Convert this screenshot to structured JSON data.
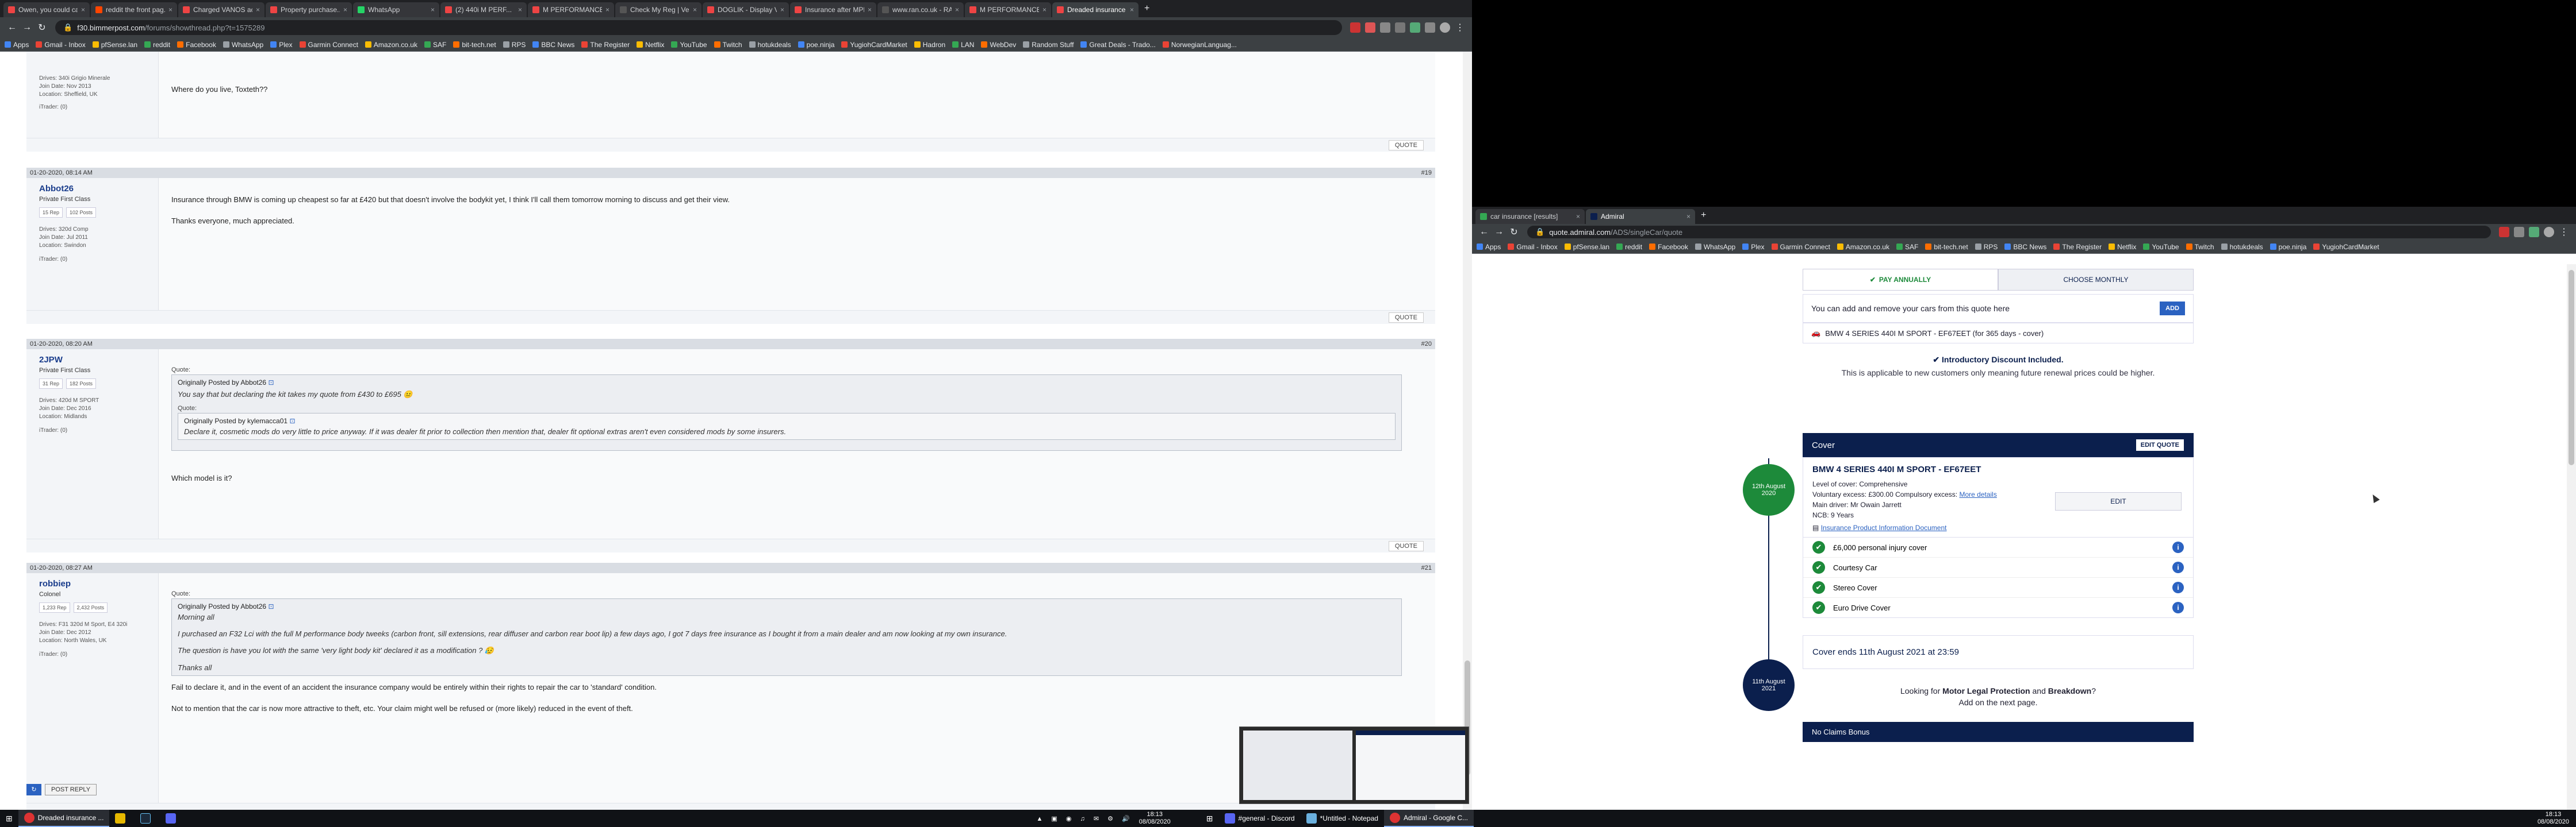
{
  "left_browser": {
    "tabs": [
      "Owen, you could ca...",
      "reddit the front pag...",
      "Charged VANOS acc...",
      "Property purchase...",
      "WhatsApp",
      "(2) 440i M PERF...",
      "M PERFORMANCE...",
      "Check My Reg | Veh...",
      "DOGLIK - Display Ve...",
      "Insurance after MPE...",
      "www.ran.co.uk - RAC",
      "M PERFORMANCE Ki...",
      "Dreaded insurance ..."
    ],
    "url_host": "f30.bimmerpost.com",
    "url_path": "/forums/showthread.php?t=1575289",
    "bookmarks": [
      "Apps",
      "Gmail - Inbox",
      "pfSense.lan",
      "reddit",
      "Facebook",
      "WhatsApp",
      "Plex",
      "Garmin Connect",
      "Amazon.co.uk",
      "SAF",
      "bit-tech.net",
      "RPS",
      "BBC News",
      "The Register",
      "Netflix",
      "YouTube",
      "Twitch",
      "hotukdeals",
      "poe.ninja",
      "YugiohCardMarket",
      "Hadron",
      "LAN",
      "WebDev",
      "Random Stuff",
      "Great Deals - Trado...",
      "NorwegianLanguag..."
    ]
  },
  "forum": {
    "top_snippet": {
      "side_lines": [
        "Drives: 340i Grigio Minerale",
        "Join Date: Nov 2013",
        "Location: Sheffield, UK",
        "iTrader: (0)"
      ],
      "text": "Where do you live, Toxteth??"
    },
    "posts": [
      {
        "date": "01-20-2020, 08:14 AM",
        "num": "#19",
        "user": "Abbot26",
        "title": "Private First Class",
        "stats": [
          "15 Rep",
          "102 Posts"
        ],
        "side_lines": [
          "Drives: 320d Comp",
          "Join Date: Jul 2011",
          "Location: Swindon",
          "iTrader: (0)"
        ],
        "lines": [
          "Insurance through BMW is coming up cheapest so far at £420 but that doesn't involve the bodykit yet, I think I'll call them tomorrow morning to discuss and get their view.",
          "Thanks everyone, much appreciated."
        ]
      },
      {
        "date": "01-20-2020, 08:20 AM",
        "num": "#20",
        "user": "2JPW",
        "title": "Private First Class",
        "stats": [
          "31 Rep",
          "182 Posts"
        ],
        "side_lines": [
          "Drives: 420d M SPORT",
          "Join Date: Dec 2016",
          "Location: Midlands",
          "iTrader: (0)"
        ],
        "quote_by": "Originally Posted by Abbot26",
        "quote_text": "You say that but declaring the kit takes my quote from £430 to £695 😐",
        "inner_quote_by": "Originally Posted by kylemacca01",
        "inner_quote_text": "Declare it, cosmetic mods do very little to price anyway. If it was dealer fit prior to collection then mention that, dealer fit optional extras aren't even considered mods by some insurers.",
        "reply": "Which model is it?"
      },
      {
        "date": "01-20-2020, 08:27 AM",
        "num": "#21",
        "user": "robbiep",
        "title": "Colonel",
        "stats": [
          "1,233 Rep",
          "2,432 Posts"
        ],
        "side_lines": [
          "Drives: F31 320d M Sport, E4 320i",
          "Join Date: Dec 2012",
          "Location: North Wales, UK",
          "iTrader: (0)"
        ],
        "quote_by": "Originally Posted by Abbot26",
        "quote_lines": [
          "Morning all",
          "I purchased an F32 Lci with the full M performance body tweeks (carbon front, sill extensions, rear diffuser and carbon rear boot lip) a few days ago, I got 7 days free insurance as I bought it from a main dealer and am now looking at my own insurance.",
          "The question is have you lot with the same 'very light body kit' declared it as a modification ? 😥",
          "Thanks all"
        ],
        "reply_lines": [
          "Fail to declare it, and in the event of an accident the insurance company would be entirely within their rights to repair the car to 'standard' condition.",
          "Not to mention that the car is now more attractive to theft, etc. Your claim might well be refused or (more likely) reduced in the event of theft."
        ]
      }
    ],
    "quote_label": "Quote:",
    "quote_button": "QUOTE",
    "post_reply": "POST REPLY"
  },
  "right_browser": {
    "tabs": [
      "car insurance [results]",
      "Admiral"
    ],
    "url_host": "quote.admiral.com",
    "url_path": "/ADS/singleCar/quote",
    "bookmarks": [
      "Apps",
      "Gmail - Inbox",
      "pfSense.lan",
      "reddit",
      "Facebook",
      "WhatsApp",
      "Plex",
      "Garmin Connect",
      "Amazon.co.uk",
      "SAF",
      "bit-tech.net",
      "RPS",
      "BBC News",
      "The Register",
      "Netflix",
      "YouTube",
      "Twitch",
      "hotukdeals",
      "poe.ninja",
      "YugiohCardMarket"
    ]
  },
  "admiral": {
    "pay_annually": "PAY ANNUALLY",
    "choose_monthly": "CHOOSE MONTHLY",
    "add_remove": "You can add and remove your cars from this quote here",
    "add_btn": "ADD",
    "car_line": "BMW 4 SERIES 440I M SPORT - EF67EET (for 365 days - cover)",
    "intro_title": "Introductory Discount Included.",
    "intro_sub": "This is applicable to new customers only meaning future renewal prices could be higher.",
    "cover_title": "Cover",
    "edit_quote": "EDIT QUOTE",
    "start_date": "12th August 2020",
    "end_date": "11th August 2021",
    "vehicle": "BMW 4 SERIES 440I M SPORT - EF67EET",
    "level": "Level of cover: Comprehensive",
    "excess": "Voluntary excess: £300.00 Compulsory excess:",
    "more_details": "More details",
    "main_driver": "Main driver: Mr Owain Jarrett",
    "ncb": "NCB: 9 Years",
    "ipid": "Insurance Product Information Document",
    "edit": "EDIT",
    "features": [
      "£6,000 personal injury cover",
      "Courtesy Car",
      "Stereo Cover",
      "Euro Drive Cover"
    ],
    "cover_ends": "Cover ends 11th August 2021 at 23:59",
    "looking_pre": "Looking for",
    "looking_mlp": "Motor Legal Protection",
    "looking_and": "and",
    "looking_bd": "Breakdown",
    "looking_q": "?",
    "next_page": "Add on the next page.",
    "ncb_bonus": "No Claims Bonus"
  },
  "taskbar": {
    "left_items": [
      "Dreaded insurance ..."
    ],
    "right_items": [
      "#general - Discord",
      "*Untitled - Notepad",
      "Admiral - Google C..."
    ],
    "time_left": "18:13",
    "date_left": "08/08/2020",
    "time_right": "18:13",
    "date_right": "08/08/2020"
  },
  "colors": {
    "admiral_navy": "#0b1f4d",
    "admiral_green": "#1d8a3a",
    "forum_header": "#d9dde3",
    "chrome_dark": "#202124"
  }
}
